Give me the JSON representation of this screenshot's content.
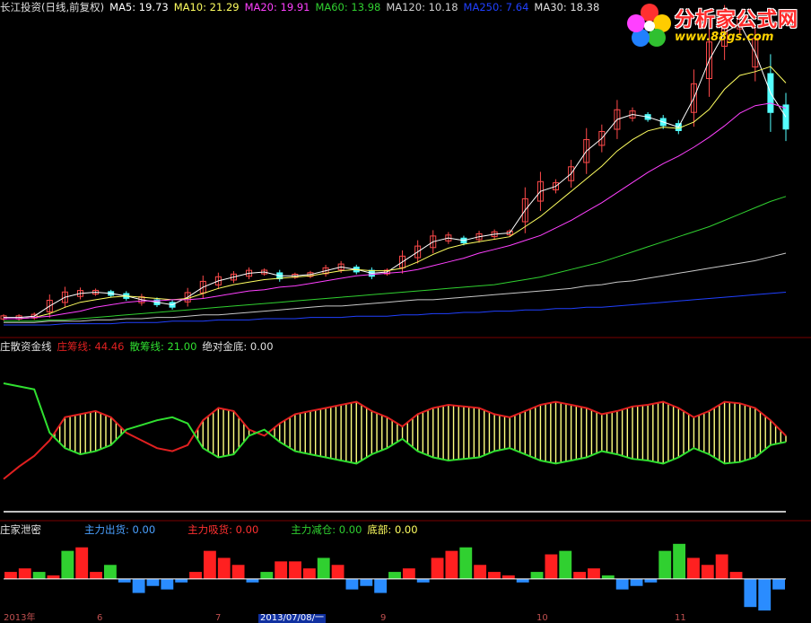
{
  "colors": {
    "background": "#000000",
    "separator": "#7a0000",
    "up": "#ff4a4a",
    "down": "#54ffff",
    "ma5": "#ffffff",
    "ma10": "#ffff60",
    "ma20": "#ff40ff",
    "ma60": "#30d030",
    "ma120": "#c8c8c8",
    "ma250": "#2040ff",
    "zhuang": "#e02020",
    "san": "#30e030",
    "fill": "#ffff80",
    "blue_label": "#4aa0ff"
  },
  "header": {
    "stock": "长江投资(日线,前复权)",
    "ma5": "MA5: 19.73",
    "ma10": "MA10: 21.29",
    "ma20": "MA20: 19.91",
    "ma60": "MA60: 13.98",
    "ma120": "MA120: 10.18",
    "ma250": "MA250: 7.64",
    "ma30": "MA30: 18.38"
  },
  "logo": {
    "name": "分析家公式网",
    "url": "www.88gs.com"
  },
  "panel2": {
    "title": "庄散资金线",
    "zhuang": "庄筹线: 44.46",
    "san": "散筹线: 21.00",
    "abs_bottom": "绝对金底: 0.00"
  },
  "panel3": {
    "title": "庄家泄密",
    "out": "主力出货: 0.00",
    "absorb": "主力吸货: 0.00",
    "reduce": "主力减仓: 0.00",
    "bottom": "底部: 0.00"
  },
  "date_axis": {
    "labels": [
      "2013年",
      "6",
      "7",
      "2013/07/08/一",
      "9",
      "10",
      "11"
    ]
  },
  "chart_data": [
    {
      "type": "line",
      "title": "长江投资(日线,前复权)",
      "xlabel": "",
      "ylabel": "",
      "ylim": [
        5,
        29.5
      ],
      "series": [
        {
          "name": "MA5",
          "values": [
            5.6,
            5.6,
            5.7,
            6.5,
            7.2,
            7.5,
            7.6,
            7.5,
            7.3,
            7.0,
            6.8,
            6.6,
            7.2,
            8.0,
            8.5,
            8.8,
            9.1,
            9.2,
            8.9,
            8.9,
            9.0,
            9.3,
            9.6,
            9.4,
            9.1,
            9.2,
            10.0,
            10.8,
            11.6,
            11.9,
            11.7,
            12.0,
            12.2,
            12.3,
            14.1,
            15.6,
            16.0,
            17.0,
            18.8,
            19.8,
            21.3,
            21.7,
            21.5,
            21.1,
            20.7,
            23.0,
            26.0,
            28.2,
            28.9,
            26.6,
            23.4,
            21.5
          ]
        },
        {
          "name": "MA10",
          "values": [
            5.5,
            5.5,
            5.6,
            5.9,
            6.4,
            6.8,
            7.0,
            7.2,
            7.3,
            7.2,
            7.1,
            7.0,
            7.1,
            7.5,
            7.9,
            8.2,
            8.4,
            8.6,
            8.7,
            8.8,
            8.9,
            9.1,
            9.3,
            9.4,
            9.3,
            9.3,
            9.5,
            10.0,
            10.6,
            11.1,
            11.4,
            11.6,
            11.8,
            12.0,
            12.8,
            13.6,
            14.6,
            15.6,
            16.6,
            17.6,
            18.8,
            19.7,
            20.4,
            20.7,
            20.6,
            21.1,
            22.1,
            23.7,
            24.8,
            25.1,
            25.5,
            24.2
          ]
        },
        {
          "name": "MA20",
          "values": [
            5.5,
            5.5,
            5.6,
            5.7,
            5.9,
            6.1,
            6.4,
            6.6,
            6.8,
            6.9,
            6.9,
            7.0,
            7.0,
            7.1,
            7.3,
            7.5,
            7.7,
            7.8,
            8.0,
            8.1,
            8.3,
            8.5,
            8.7,
            8.9,
            9.0,
            9.1,
            9.2,
            9.4,
            9.7,
            10.0,
            10.3,
            10.7,
            11.0,
            11.3,
            11.7,
            12.1,
            12.7,
            13.3,
            14.0,
            14.7,
            15.5,
            16.3,
            17.1,
            17.8,
            18.4,
            19.1,
            19.9,
            20.8,
            21.8,
            22.4,
            22.6,
            22.2
          ]
        },
        {
          "name": "MA60",
          "values": [
            5.3,
            5.3,
            5.3,
            5.4,
            5.4,
            5.5,
            5.6,
            5.7,
            5.8,
            5.9,
            6.0,
            6.1,
            6.2,
            6.3,
            6.4,
            6.5,
            6.6,
            6.7,
            6.8,
            6.9,
            7.0,
            7.1,
            7.2,
            7.3,
            7.4,
            7.5,
            7.6,
            7.7,
            7.8,
            7.9,
            8.0,
            8.1,
            8.2,
            8.4,
            8.6,
            8.8,
            9.1,
            9.4,
            9.7,
            10.0,
            10.4,
            10.8,
            11.2,
            11.6,
            12.0,
            12.4,
            12.8,
            13.3,
            13.8,
            14.3,
            14.8,
            15.2
          ]
        },
        {
          "name": "MA120",
          "values": [
            5.2,
            5.2,
            5.2,
            5.3,
            5.3,
            5.3,
            5.4,
            5.4,
            5.5,
            5.5,
            5.6,
            5.6,
            5.7,
            5.8,
            5.8,
            5.9,
            6.0,
            6.1,
            6.2,
            6.3,
            6.4,
            6.5,
            6.5,
            6.6,
            6.7,
            6.8,
            6.9,
            7.0,
            7.0,
            7.1,
            7.2,
            7.3,
            7.4,
            7.5,
            7.6,
            7.7,
            7.8,
            7.9,
            8.1,
            8.2,
            8.4,
            8.5,
            8.7,
            8.9,
            9.1,
            9.3,
            9.5,
            9.7,
            9.9,
            10.1,
            10.4,
            10.7
          ]
        },
        {
          "name": "MA250",
          "values": [
            5.0,
            5.0,
            5.0,
            5.0,
            5.1,
            5.1,
            5.1,
            5.1,
            5.2,
            5.2,
            5.2,
            5.3,
            5.3,
            5.3,
            5.4,
            5.4,
            5.4,
            5.5,
            5.5,
            5.5,
            5.6,
            5.6,
            5.6,
            5.7,
            5.7,
            5.7,
            5.8,
            5.8,
            5.9,
            5.9,
            6.0,
            6.0,
            6.1,
            6.1,
            6.2,
            6.2,
            6.3,
            6.3,
            6.4,
            6.4,
            6.5,
            6.6,
            6.7,
            6.8,
            6.9,
            7.0,
            7.1,
            7.2,
            7.3,
            7.4,
            7.5,
            7.6
          ]
        }
      ]
    },
    {
      "type": "area",
      "title": "庄散资金线",
      "xlabel": "",
      "ylabel": "",
      "ylim": [
        0,
        100
      ],
      "series": [
        {
          "name": "庄筹线",
          "values": [
            20,
            28,
            35,
            45,
            60,
            62,
            64,
            60,
            50,
            45,
            40,
            38,
            42,
            58,
            66,
            64,
            52,
            48,
            56,
            62,
            64,
            66,
            68,
            70,
            64,
            60,
            54,
            62,
            66,
            68,
            67,
            66,
            62,
            60,
            64,
            68,
            70,
            68,
            66,
            62,
            64,
            67,
            68,
            70,
            66,
            60,
            64,
            70,
            69,
            66,
            58,
            48
          ]
        },
        {
          "name": "散筹线",
          "values": [
            82,
            80,
            78,
            50,
            40,
            36,
            38,
            42,
            52,
            55,
            58,
            60,
            56,
            40,
            34,
            36,
            48,
            52,
            44,
            38,
            36,
            34,
            32,
            30,
            36,
            40,
            46,
            38,
            34,
            32,
            33,
            34,
            38,
            40,
            36,
            32,
            30,
            32,
            34,
            38,
            36,
            33,
            32,
            30,
            34,
            40,
            36,
            30,
            31,
            34,
            42,
            44
          ]
        }
      ]
    },
    {
      "type": "bar",
      "title": "庄家泄密",
      "xlabel": "",
      "ylabel": "",
      "ylim": [
        -10,
        12
      ],
      "values": [
        2,
        3,
        2,
        1,
        8,
        9,
        2,
        4,
        -1,
        -4,
        -2,
        -3,
        -1,
        2,
        8,
        6,
        4,
        -1,
        2,
        5,
        5,
        3,
        6,
        4,
        -3,
        -2,
        -4,
        2,
        3,
        -1,
        6,
        8,
        9,
        4,
        2,
        1,
        -1,
        2,
        7,
        8,
        2,
        3,
        1,
        -3,
        -2,
        -1,
        8,
        10,
        6,
        4,
        7,
        2,
        -8,
        -9,
        -3
      ]
    }
  ]
}
